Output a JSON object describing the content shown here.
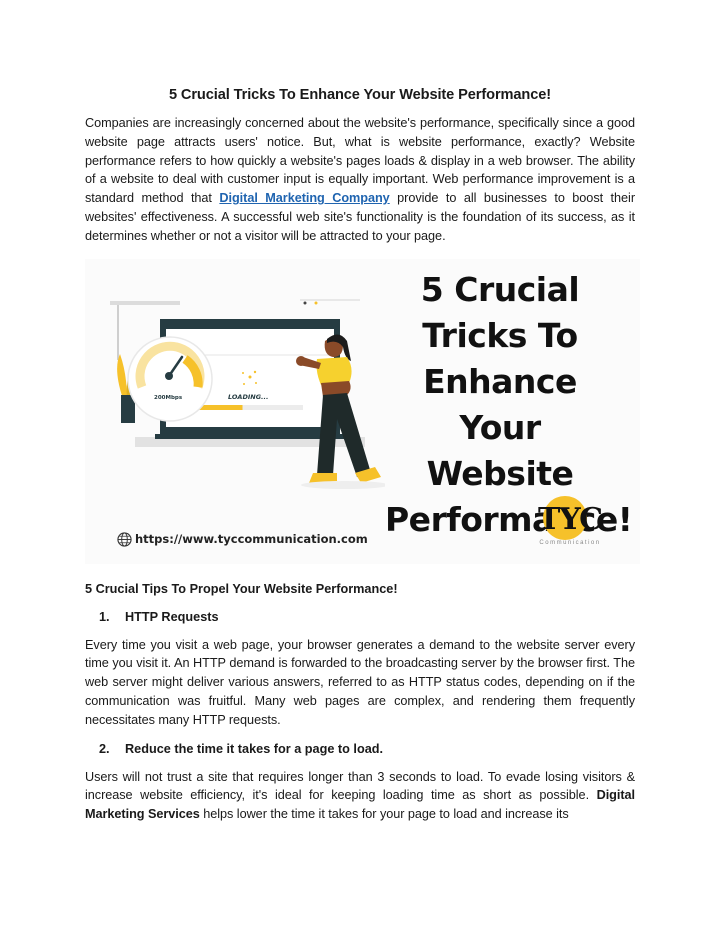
{
  "document": {
    "title": "5 Crucial Tricks To Enhance Your Website Performance!",
    "intro": {
      "before_link": "Companies are increasingly concerned about the website's performance, specifically since a good website page attracts users' notice. But, what is website performance, exactly? Website performance refers to how quickly a website's pages loads & display in a web browser. The ability of a website to deal with customer input is equally important. Web performance improvement is a standard method that ",
      "link_text": "Digital Marketing Company",
      "after_link": " provide to all businesses to boost their websites' effectiveness. A successful web site's functionality is the foundation of its success, as it determines whether or not a visitor will be attracted to your page."
    },
    "hero_image": {
      "headline_lines": [
        "5 Crucial",
        "Tricks To",
        "Enhance Your",
        "Website",
        "Performance!"
      ],
      "speedometer_label": "200Mbps",
      "loading_label": "LOADING...",
      "loading_progress_percent": 45,
      "url": "https://www.tyccommunication.com",
      "logo_text": "TYC",
      "logo_subtext": "Communication",
      "accent_color": "#f6c12a",
      "dark_color": "#263c42"
    },
    "section_heading": "5 Crucial Tips To Propel Your Website Performance!",
    "items": [
      {
        "number": "1.",
        "heading": "HTTP Requests",
        "body": "Every time you visit a web page, your browser generates a demand to the website server every time you visit it. An HTTP demand is forwarded to the broadcasting server by the browser first. The web server might deliver various answers, referred to as HTTP status codes, depending on if the communication was fruitful. Many web pages are complex, and rendering them frequently necessitates many HTTP requests."
      },
      {
        "number": "2.",
        "heading": "Reduce the time it takes for a page to load.",
        "body_before_bold": "Users will not trust a site that requires longer than 3 seconds to load. To evade losing visitors & increase website efficiency, it's ideal for keeping loading time as short as possible. ",
        "body_bold": "Digital Marketing Services",
        "body_after_bold": " helps lower the time it takes for your page to load and increase its"
      }
    ],
    "link_color": "#1f64b0"
  }
}
